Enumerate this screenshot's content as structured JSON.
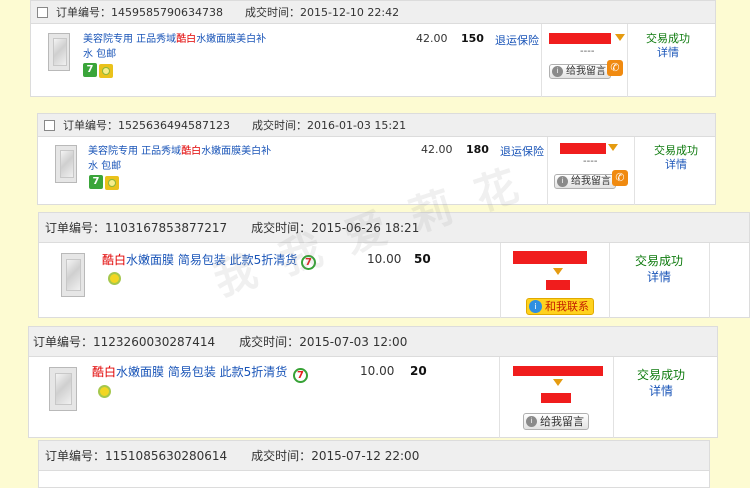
{
  "labels": {
    "order_no": "订单编号：",
    "deal_time": "成交时间：",
    "insurance": "退运保险",
    "leave_msg": "给我留言",
    "contact_me": "和我联系",
    "status": "交易成功",
    "detail": "详情",
    "dashes": "----"
  },
  "orders": [
    {
      "no": "1459585790634738",
      "time": "2015-12-10 22:42",
      "title_pre": "美容院专用 正品秀域",
      "title_hl": "酷白",
      "title_post": "水嫩面膜美白补水 包邮",
      "price": "42.00",
      "qty": "150"
    },
    {
      "no": "1525636494587123",
      "time": "2016-01-03 15:21",
      "title_pre": "美容院专用 正品秀域",
      "title_hl": "酷白",
      "title_post": "水嫩面膜美白补水 包邮",
      "price": "42.00",
      "qty": "180"
    },
    {
      "no": "1103167853877217",
      "time": "2015-06-26 18:21",
      "title_pre": "",
      "title_hl": "酷白",
      "title_post": "水嫩面膜 简易包装 此款5折清货",
      "price": "10.00",
      "qty": "50"
    },
    {
      "no": "1123260030287414",
      "time": "2015-07-03 12:00",
      "title_pre": "",
      "title_hl": "酷白",
      "title_post": "水嫩面膜 简易包装 此款5折清货",
      "price": "10.00",
      "qty": "20"
    },
    {
      "no": "1151085630280614",
      "time": "2015-07-12 22:00"
    }
  ],
  "watermark": "我 我 爱 莉 花",
  "colors": {
    "link": "#1a55b8",
    "highlight": "#e10000",
    "success": "#0d7a0d",
    "background": "#fdfbd2"
  }
}
